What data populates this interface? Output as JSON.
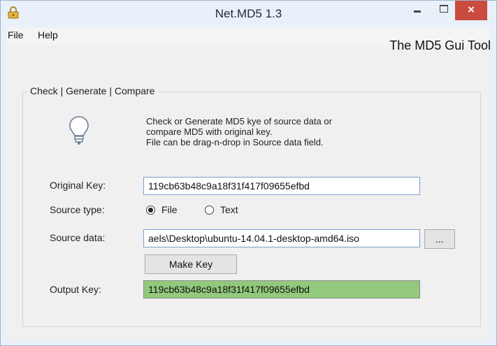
{
  "window": {
    "title": "Net.MD5 1.3",
    "icon": "lock-icon",
    "minimize_icon": "minimize-icon",
    "maximize_icon": "maximize-icon",
    "close_label": "×"
  },
  "menu": {
    "file": "File",
    "help": "Help"
  },
  "header": {
    "tool_title": "The MD5 Gui Tool"
  },
  "group": {
    "label": "Check | Generate | Compare",
    "icon": "lightbulb-icon"
  },
  "description": {
    "line1": "Check or Generate MD5 kye of source data or",
    "line2": "compare MD5 with original key.",
    "line3": "File can be drag-n-drop in Source data field."
  },
  "form": {
    "original_key_label": "Original Key:",
    "original_key_value": "119cb63b48c9a18f31f417f09655efbd",
    "source_type_label": "Source type:",
    "source_type_options": [
      "File",
      "Text"
    ],
    "source_type_selected": "File",
    "source_data_label": "Source data:",
    "source_data_value": "aels\\Desktop\\ubuntu-14.04.1-desktop-amd64.iso",
    "browse_label": "...",
    "make_key_label": "Make Key",
    "output_key_label": "Output Key:",
    "output_key_value": "119cb63b48c9a18f31f417f09655efbd"
  },
  "colors": {
    "output_background": "#92c97c",
    "close_button": "#c94c3f",
    "textbox_border": "#7a9fc9"
  }
}
